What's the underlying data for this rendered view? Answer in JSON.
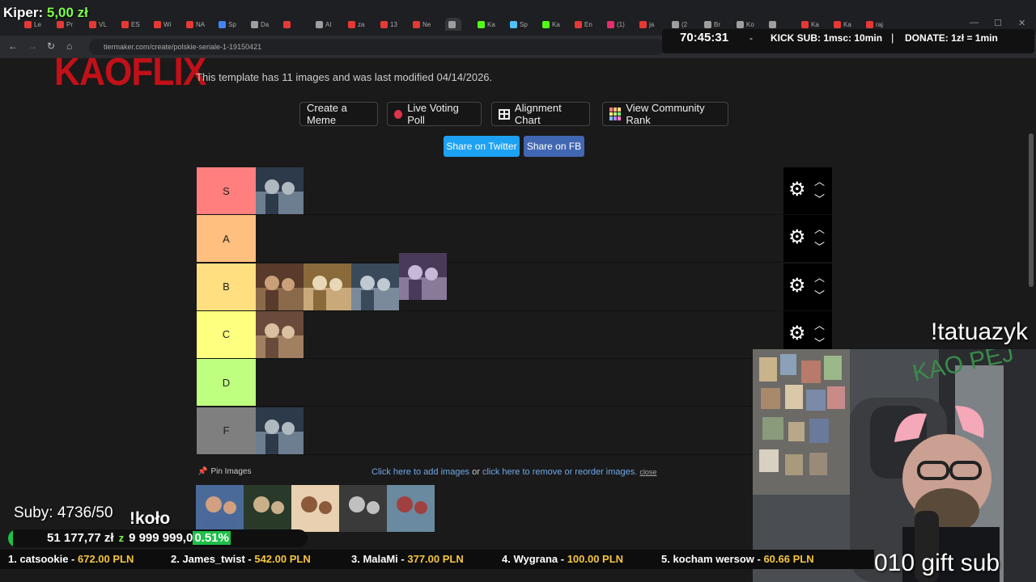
{
  "overlay": {
    "donation_name": "Kiper:",
    "donation_amount": "5,00 zł",
    "timer": "70:45:31",
    "kick_sub": "KICK SUB: 1msc: 10min",
    "donate": "DONATE: 1zł = 1min",
    "command": "!tatuazyk",
    "gift": "010 gift sub",
    "subs": "Suby: 4736/50",
    "kolo": "!koło",
    "goal_current": "51 177,77 zł",
    "goal_sep": "z",
    "goal_target": "9 999 999,0",
    "goal_percent": "0.51%",
    "goal_fraction": 0.0051,
    "leaderboard": [
      {
        "rank": "1. catsookie",
        "amount": "672.00 PLN"
      },
      {
        "rank": "2. James_twist",
        "amount": "542.00 PLN"
      },
      {
        "rank": "3. MalaMi",
        "amount": "377.00 PLN"
      },
      {
        "rank": "4. Wygrana",
        "amount": "100.00 PLN"
      },
      {
        "rank": "5. kocham wersow",
        "amount": "60.66 PLN"
      }
    ]
  },
  "browser": {
    "url": "tiermaker.com/create/polskie-seriale-1-19150421",
    "tabs": [
      "Le",
      "Pr",
      "VL",
      "ES",
      "Wi",
      "NA",
      "Sp",
      "Da",
      "",
      "AI",
      "za",
      "13",
      "Ne",
      "",
      "Ka",
      "Sp",
      "Ka",
      "En",
      "(1)",
      "ja",
      "(2",
      "Br",
      "Ko",
      "",
      "Ka",
      "Ka",
      "raj"
    ]
  },
  "page": {
    "logo": "KAOFLIX",
    "template_info": "This template has 11 images and was last modified 04/14/2026.",
    "buttons": {
      "meme": "Create a Meme",
      "poll": "Live Voting Poll",
      "alignment": "Alignment Chart",
      "community": "View Community Rank",
      "twitter": "Share on Twitter",
      "fb": "Share on FB"
    },
    "tiers": [
      {
        "label": "S",
        "color": "#ff7f7f",
        "count": 1
      },
      {
        "label": "A",
        "color": "#ffbf7f",
        "count": 0
      },
      {
        "label": "B",
        "color": "#ffdf7f",
        "count": 4
      },
      {
        "label": "C",
        "color": "#ffff7f",
        "count": 1
      },
      {
        "label": "D",
        "color": "#bfff7f",
        "count": 0
      },
      {
        "label": "F",
        "color": "#7f7f7f",
        "count": 1
      }
    ],
    "pin_images": "Pin Images",
    "help_add": "Click here to add images",
    "help_or": "or",
    "help_remove": "click here to remove or reorder images.",
    "help_close": "close",
    "pool_count": 5
  }
}
